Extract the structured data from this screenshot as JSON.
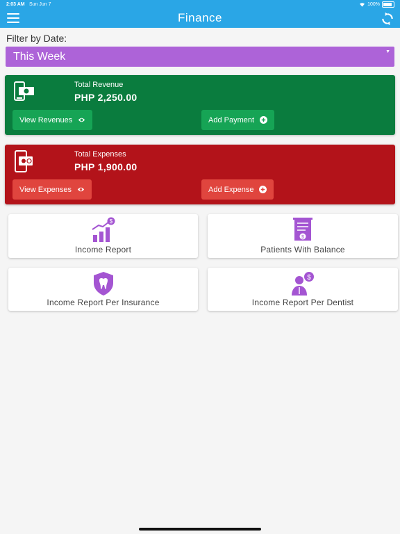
{
  "status_bar": {
    "time": "2:03 AM",
    "date": "Sun Jun 7",
    "battery": "100%"
  },
  "header": {
    "title": "Finance",
    "menu_icon": "hamburger-menu-icon",
    "refresh_icon": "refresh-icon"
  },
  "filter": {
    "label": "Filter by Date:",
    "selected": "This Week"
  },
  "revenue": {
    "label": "Total Revenue",
    "amount": "PHP 2,250.00",
    "view_button": "View Revenues",
    "add_button": "Add Payment",
    "color": "#0a7c3e"
  },
  "expenses": {
    "label": "Total Expenses",
    "amount": "PHP 1,900.00",
    "view_button": "View Expenses",
    "add_button": "Add Expense",
    "color": "#b3131a"
  },
  "tiles": [
    {
      "label": "Income Report",
      "icon": "chart-growth-icon"
    },
    {
      "label": "Patients With Balance",
      "icon": "invoice-icon"
    },
    {
      "label": "Income Report Per Insurance",
      "icon": "tooth-shield-icon"
    },
    {
      "label": "Income Report Per Dentist",
      "icon": "dentist-money-icon"
    }
  ],
  "colors": {
    "header": "#2aa6e6",
    "filter": "#ad63d8",
    "icon_purple": "#a455d2"
  }
}
